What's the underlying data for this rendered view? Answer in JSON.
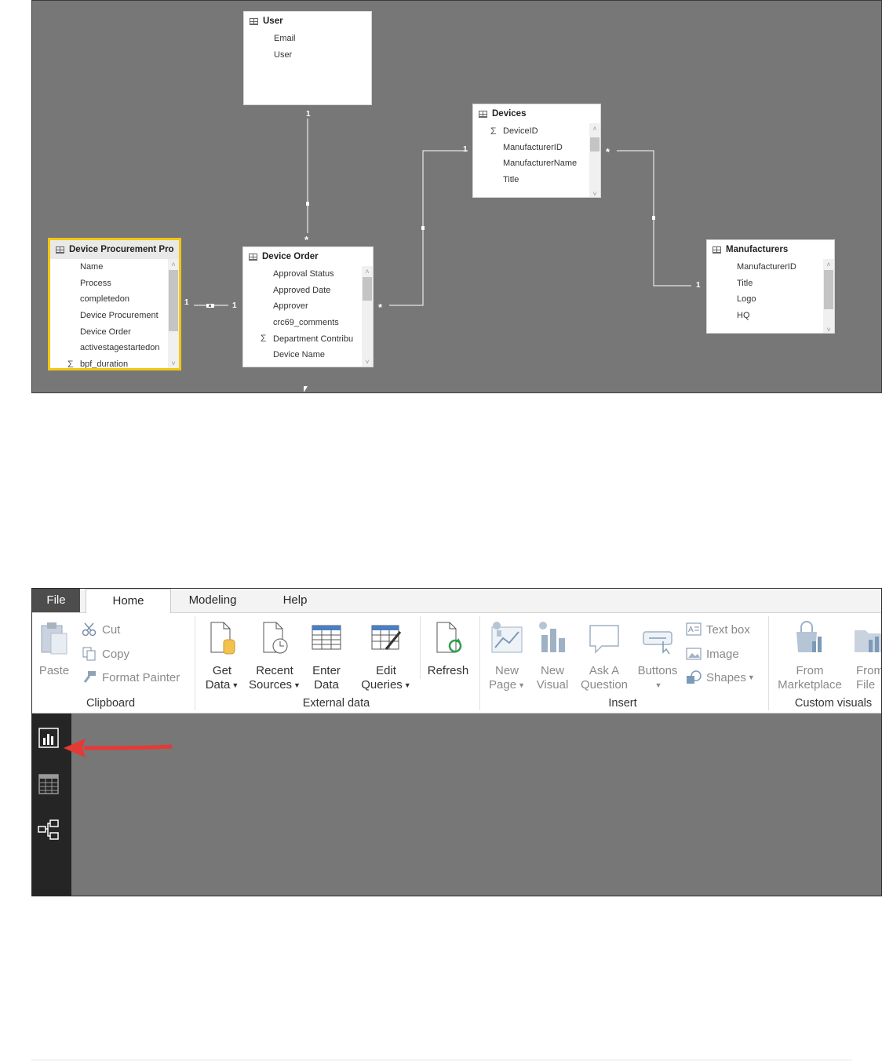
{
  "diagram": {
    "tables": {
      "user": {
        "title": "User",
        "fields": [
          "Email",
          "User"
        ]
      },
      "devices": {
        "title": "Devices",
        "fields": [
          "DeviceID",
          "ManufacturerID",
          "ManufacturerName",
          "Title"
        ]
      },
      "manufacturers": {
        "title": "Manufacturers",
        "fields": [
          "ManufacturerID",
          "Title",
          "Logo",
          "HQ"
        ]
      },
      "procurement": {
        "title": "Device Procurement Pro",
        "fields": [
          "Name",
          "Process",
          "completedon",
          "Device Procurement",
          "Device Order",
          "activestagestartedon",
          "bpf_duration"
        ]
      },
      "device_order": {
        "title": "Device Order",
        "fields": [
          "Approval Status",
          "Approved Date",
          "Approver",
          "crc69_comments",
          "Department Contribu",
          "Device Name"
        ]
      }
    },
    "cardinality": {
      "user_one": "1",
      "order_many_user": "*",
      "devices_one": "1",
      "order_many_devices": "*",
      "devices_many": "*",
      "manufacturers_one": "1",
      "procurement_one": "1",
      "order_one": "1"
    }
  },
  "pbi": {
    "tabs": [
      "File",
      "Home",
      "Modeling",
      "Help"
    ],
    "clipboard": {
      "paste": "Paste",
      "cut": "Cut",
      "copy": "Copy",
      "format_painter": "Format Painter",
      "group": "Clipboard"
    },
    "external": {
      "get_data": [
        "Get",
        "Data"
      ],
      "recent_sources": [
        "Recent",
        "Sources"
      ],
      "enter_data": [
        "Enter",
        "Data"
      ],
      "edit_queries": [
        "Edit",
        "Queries"
      ],
      "refresh": "Refresh",
      "group": "External data"
    },
    "insert": {
      "new_page": [
        "New",
        "Page"
      ],
      "new_visual": [
        "New",
        "Visual"
      ],
      "ask_question": [
        "Ask A",
        "Question"
      ],
      "buttons": "Buttons",
      "text_box": "Text box",
      "image": "Image",
      "shapes": "Shapes",
      "group": "Insert"
    },
    "custom": {
      "marketplace": [
        "From",
        "Marketplace"
      ],
      "file": [
        "From",
        "File"
      ],
      "group": "Custom visuals"
    },
    "nav_icons": [
      "report-view-icon",
      "data-view-icon",
      "relationships-view-icon"
    ],
    "arrow_color": "#e53935"
  }
}
